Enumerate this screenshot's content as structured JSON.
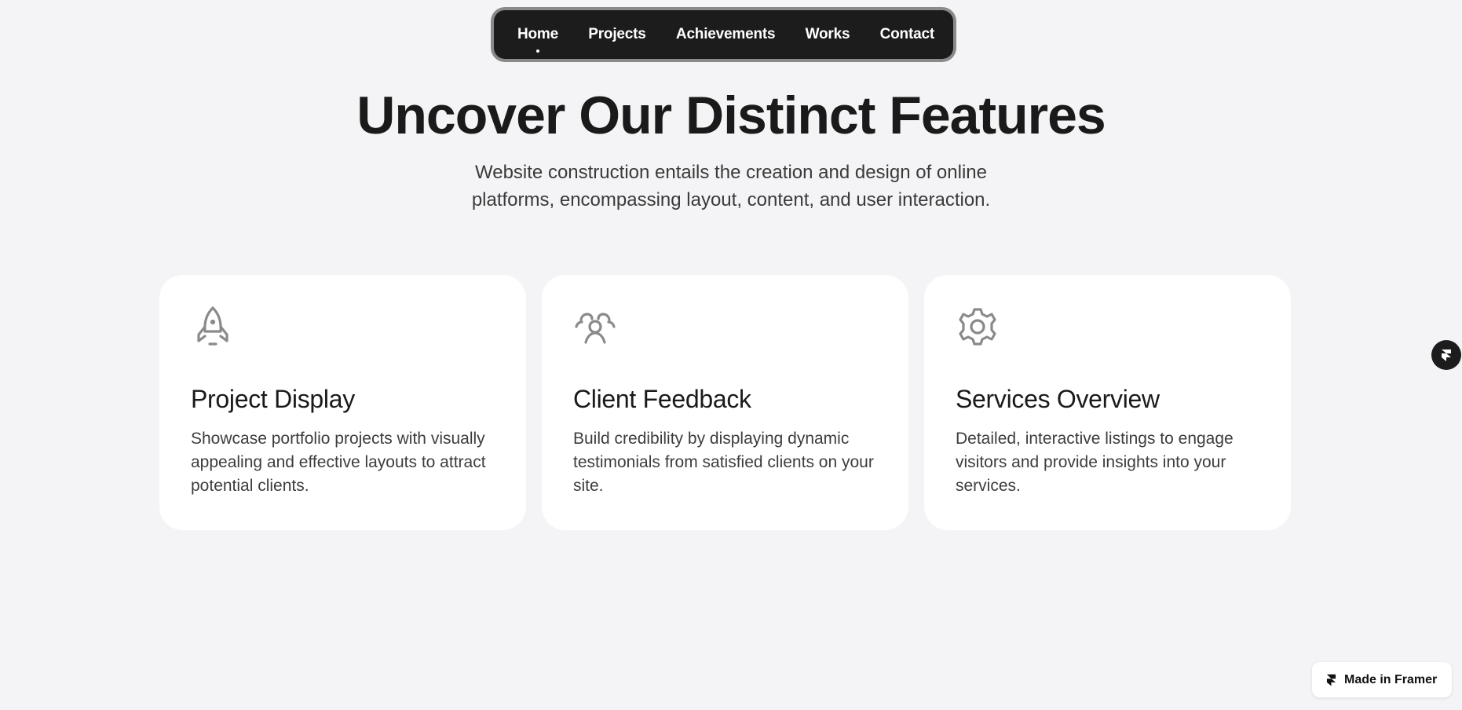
{
  "nav": {
    "items": [
      {
        "label": "Home",
        "active": true
      },
      {
        "label": "Projects"
      },
      {
        "label": "Achievements"
      },
      {
        "label": "Works"
      },
      {
        "label": "Contact"
      }
    ]
  },
  "hero": {
    "title": "Uncover Our Distinct Features",
    "subtitle_line1": "Website construction entails the creation and design of online",
    "subtitle_line2": "platforms, encompassing layout, content, and user interaction."
  },
  "cards": [
    {
      "icon": "rocket-icon",
      "title": "Project Display",
      "text": "Showcase portfolio projects with visually appealing and effective layouts to attract potential clients."
    },
    {
      "icon": "users-icon",
      "title": "Client Feedback",
      "text": "Build credibility by displaying dynamic testimonials from satisfied clients on your site."
    },
    {
      "icon": "gear-icon",
      "title": "Services Overview",
      "text": "Detailed, interactive listings to engage visitors and provide insights into your services."
    }
  ],
  "badge": {
    "label": "Made in Framer"
  },
  "colors": {
    "background": "#f4f4f6",
    "nav_bg": "#1c1c1c",
    "card_bg": "#ffffff",
    "icon_stroke": "#8a8a8a",
    "text_dark": "#1a1a1a"
  }
}
